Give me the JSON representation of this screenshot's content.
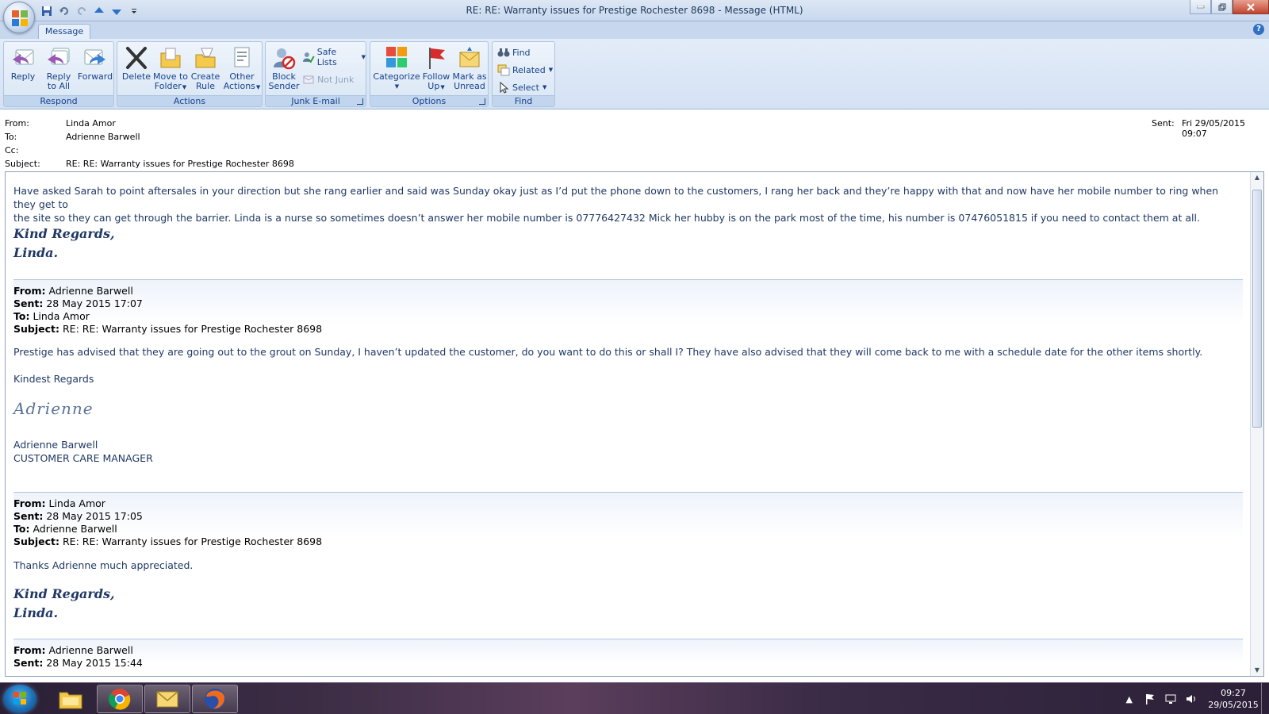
{
  "window": {
    "title": "RE: RE: Warranty issues for Prestige Rochester  8698 - Message (HTML)"
  },
  "ribbon": {
    "tab": "Message",
    "groups": {
      "respond": "Respond",
      "actions": "Actions",
      "junk": "Junk E-mail",
      "options": "Options",
      "find": "Find"
    },
    "buttons": {
      "reply": "Reply",
      "reply_all_1": "Reply",
      "reply_all_2": "to All",
      "forward": "Forward",
      "delete": "Delete",
      "move_1": "Move to",
      "move_2": "Folder",
      "rule_1": "Create",
      "rule_2": "Rule",
      "other_1": "Other",
      "other_2": "Actions",
      "block_1": "Block",
      "block_2": "Sender",
      "safe_lists": "Safe Lists",
      "not_junk": "Not Junk",
      "categorize": "Categorize",
      "follow_1": "Follow",
      "follow_2": "Up",
      "mark_1": "Mark as",
      "mark_2": "Unread",
      "find": "Find",
      "related": "Related",
      "select": "Select"
    }
  },
  "header": {
    "from_label": "From:",
    "from": "Linda Amor",
    "to_label": "To:",
    "to": "Adrienne Barwell",
    "cc_label": "Cc:",
    "cc": "",
    "subject_label": "Subject:",
    "subject": "RE: RE: Warranty issues for Prestige Rochester  8698",
    "sent_label": "Sent:",
    "sent": "Fri 29/05/2015 09:07"
  },
  "body": {
    "p1_line1": "Have asked Sarah to point aftersales in your direction but she rang earlier and said was Sunday okay just as I’d put the phone down to the customers, I rang her back and they’re happy with that and now have her mobile number to ring when they get to",
    "p1_line2": "the site so they can get through the barrier.  Linda is a nurse so sometimes doesn’t answer her mobile number is 07776427432 Mick her hubby is on the park most of the time, his number is 07476051815 if you need to contact them at all.",
    "sig_line1": "Kind Regards,",
    "sig_line2": "Linda.",
    "q1": {
      "from_label": "From:",
      "from": "Adrienne Barwell",
      "sent_label": "Sent:",
      "sent": "28 May 2015 17:07",
      "to_label": "To:",
      "to": "Linda Amor",
      "subject_label": "Subject:",
      "subject": "RE: RE: Warranty issues for Prestige Rochester 8698",
      "text": "Prestige has advised that they are going out to the grout on Sunday, I haven’t updated the customer, do you want to do this or  shall I?  They have also advised that they will come back to me with a schedule date for the other items shortly.",
      "regards": "Kindest Regards",
      "signature": "Adrienne",
      "name": "Adrienne Barwell",
      "role": "CUSTOMER CARE MANAGER"
    },
    "q2": {
      "from_label": "From:",
      "from": "Linda Amor",
      "sent_label": "Sent:",
      "sent": "28 May 2015 17:05",
      "to_label": "To:",
      "to": "Adrienne Barwell",
      "subject_label": "Subject:",
      "subject": "RE: RE: Warranty issues for Prestige Rochester 8698",
      "text": "Thanks Adrienne much appreciated.",
      "sig_line1": "Kind Regards,",
      "sig_line2": "Linda."
    },
    "q3": {
      "from_label": "From:",
      "from": "Adrienne Barwell",
      "sent_label": "Sent:",
      "sent": "28 May 2015 15:44"
    }
  },
  "taskbar": {
    "time": "09:27",
    "date": "29/05/2015"
  }
}
